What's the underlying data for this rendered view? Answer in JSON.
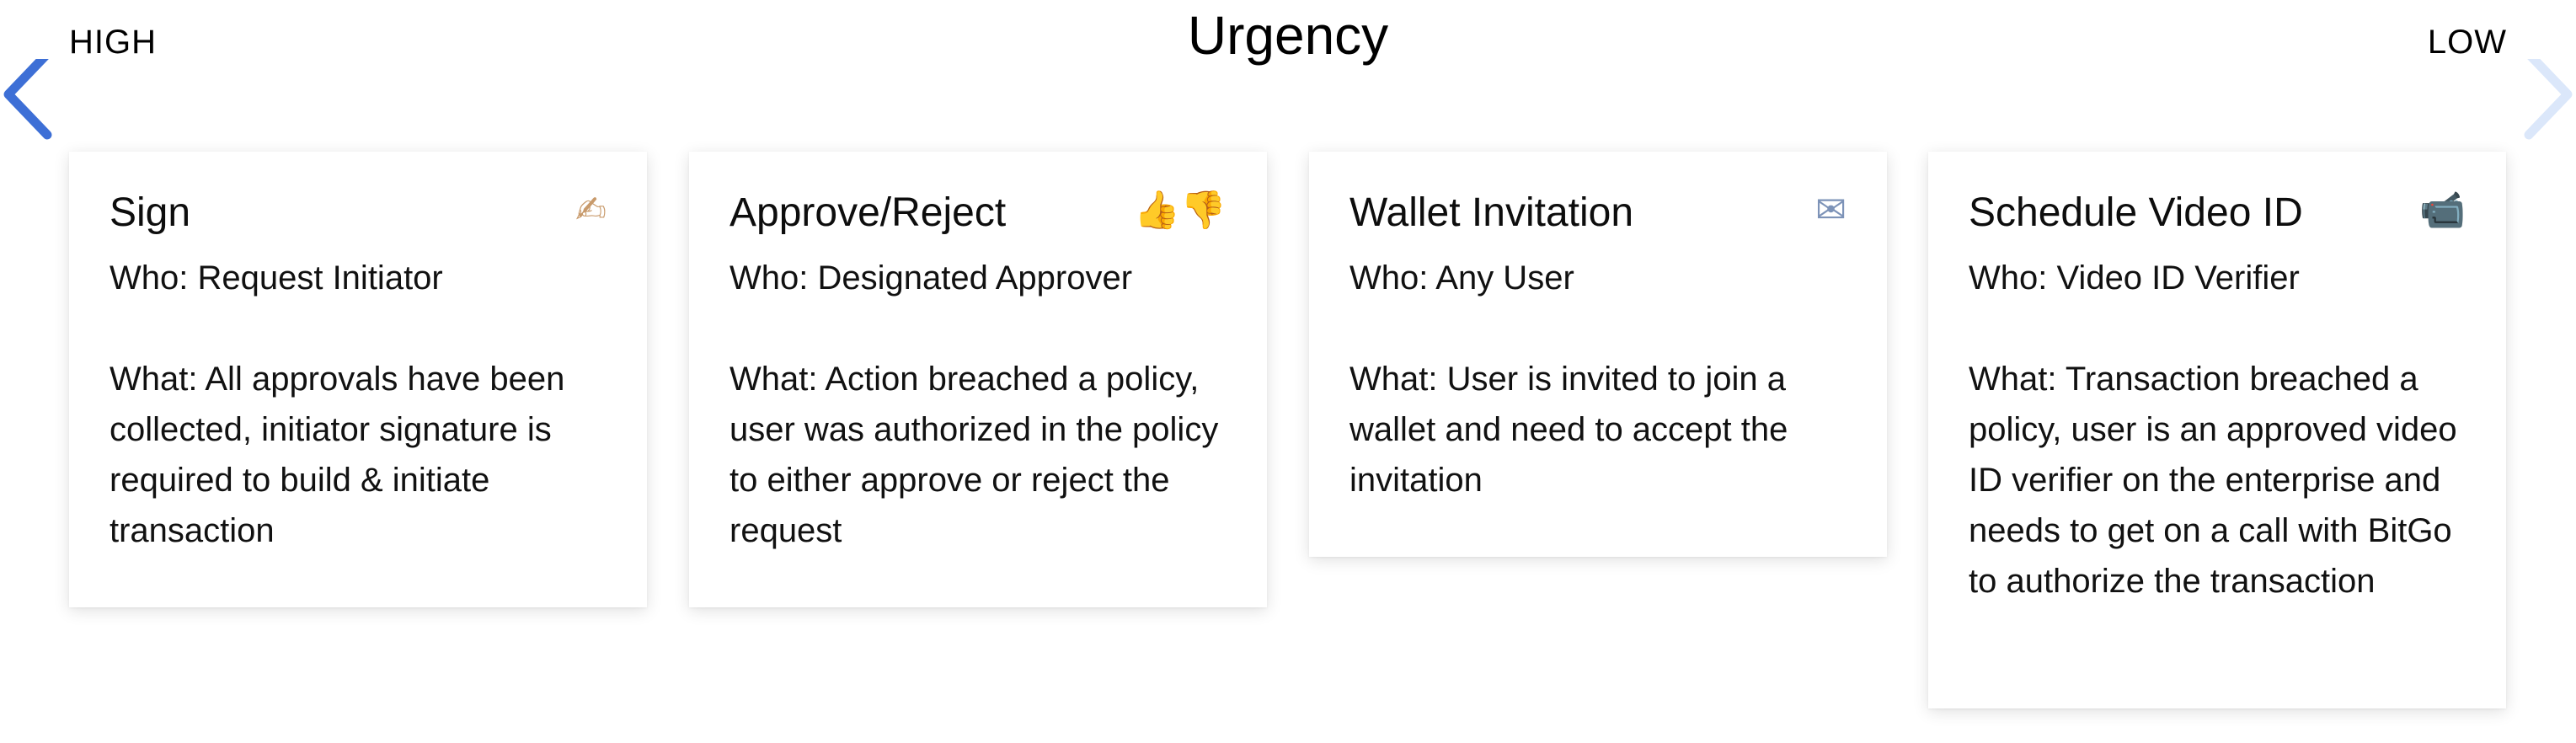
{
  "scale": {
    "title": "Urgency",
    "high_label": "HIGH",
    "low_label": "LOW",
    "gradient_start": "#3d6fd6",
    "gradient_end": "#dbe7fa"
  },
  "cards": [
    {
      "title": "Sign",
      "icon": "writing-hand-icon",
      "icon_glyph": "✍",
      "who": "Who: Request Initiator",
      "what": "What: All approvals have been collected, initiator signature is required to build & initiate transaction"
    },
    {
      "title": "Approve/Reject",
      "icon": "thumbs-up-down-icon",
      "icon_glyph": "👍👎",
      "who": "Who: Designated Approver",
      "what": "What: Action breached a policy, user was authorized in the policy to either approve or reject the request"
    },
    {
      "title": "Wallet Invitation",
      "icon": "envelope-icon",
      "icon_glyph": "✉",
      "who": "Who: Any User",
      "what": "What: User is invited to join a wallet and need to accept the invitation"
    },
    {
      "title": "Schedule Video ID",
      "icon": "video-camera-icon",
      "icon_glyph": "📹",
      "who": "Who: Video ID Verifier",
      "what": "What: Transaction breached a policy, user is an approved video ID verifier on the enterprise and needs to get on a call with BitGo to authorize the transaction"
    }
  ]
}
